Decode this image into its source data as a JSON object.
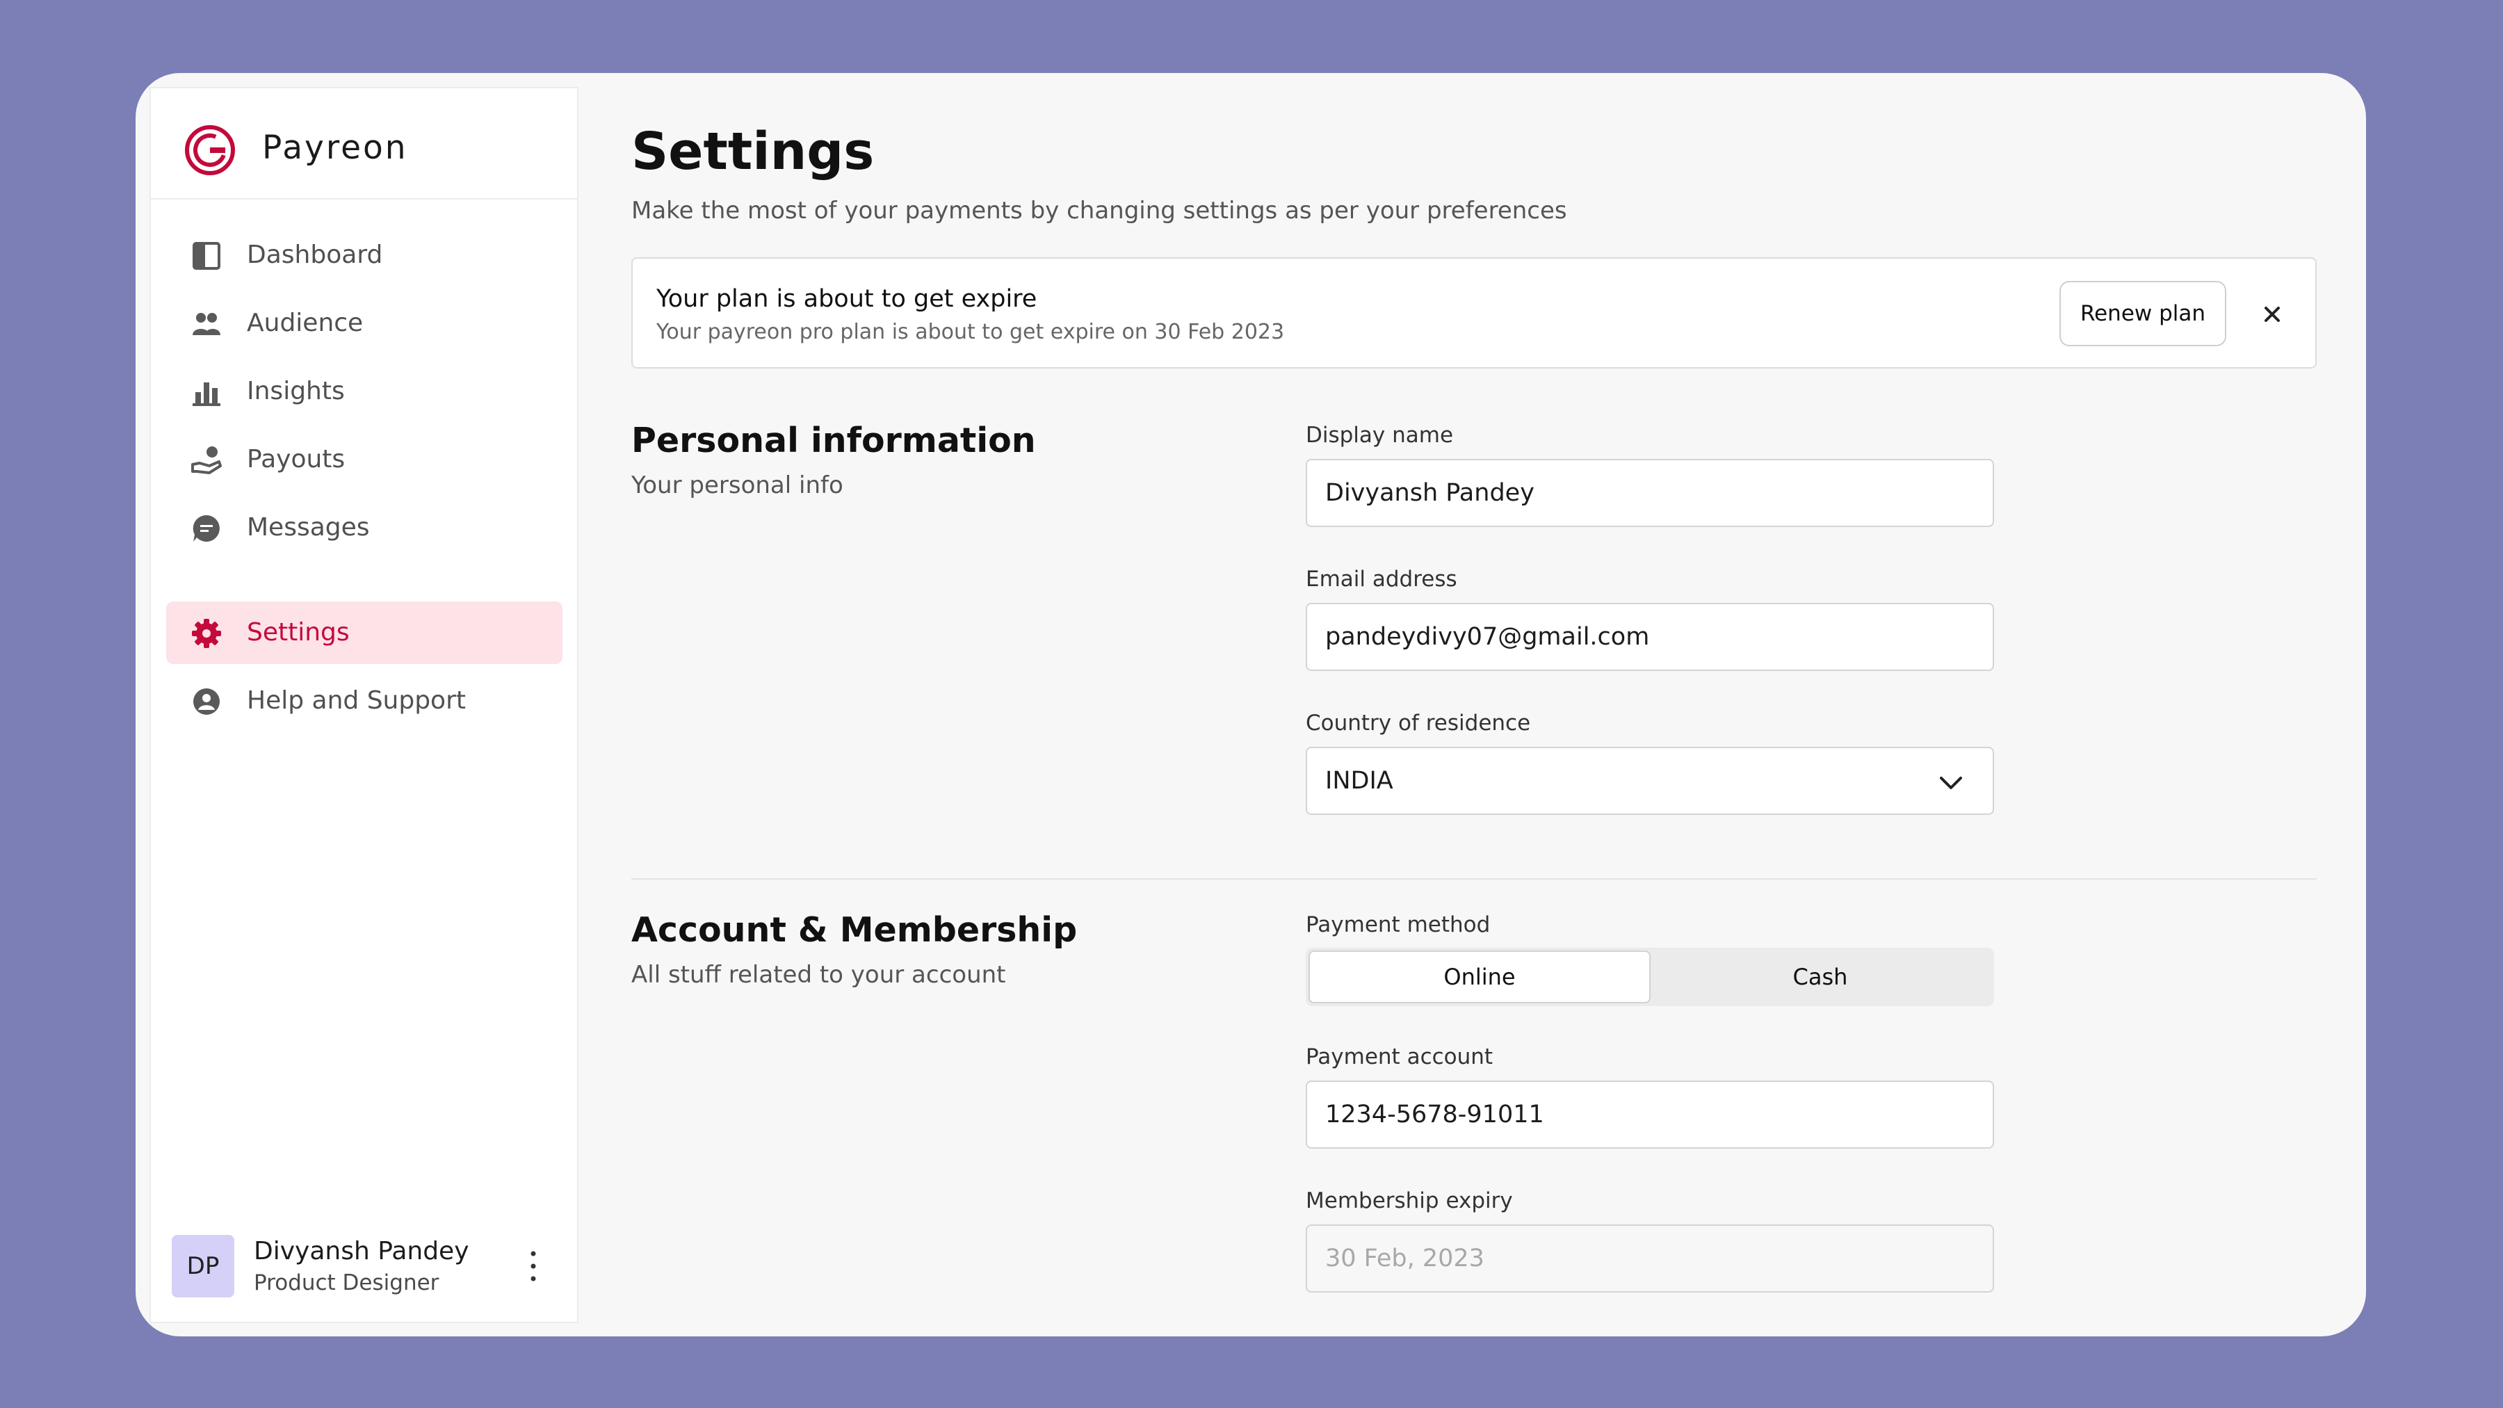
{
  "brand": {
    "name": "Payreon"
  },
  "nav": {
    "items": [
      {
        "label": "Dashboard",
        "icon": "dashboard-icon",
        "active": false
      },
      {
        "label": "Audience",
        "icon": "audience-icon",
        "active": false
      },
      {
        "label": "Insights",
        "icon": "insights-icon",
        "active": false
      },
      {
        "label": "Payouts",
        "icon": "payouts-icon",
        "active": false
      },
      {
        "label": "Messages",
        "icon": "messages-icon",
        "active": false
      },
      {
        "label": "Settings",
        "icon": "gear-icon",
        "active": true
      },
      {
        "label": "Help and Support",
        "icon": "help-icon",
        "active": false
      }
    ]
  },
  "user": {
    "initials": "DP",
    "name": "Divyansh Pandey",
    "role": "Product Designer"
  },
  "page": {
    "title": "Settings",
    "subtitle": "Make the most of your payments by changing settings as per your preferences"
  },
  "banner": {
    "title": "Your plan is about to get expire",
    "message": "Your payreon pro plan is about to get expire on 30 Feb 2023",
    "renew_label": "Renew plan"
  },
  "personal": {
    "title": "Personal information",
    "subtitle": "Your personal info",
    "display_name_label": "Display name",
    "display_name_value": "Divyansh Pandey",
    "email_label": "Email address",
    "email_value": "pandeydivy07@gmail.com",
    "country_label": "Country of residence",
    "country_value": "INDIA"
  },
  "account": {
    "title": "Account & Membership",
    "subtitle": "All stuff related to your account",
    "payment_method_label": "Payment method",
    "payment_method_options": [
      "Online",
      "Cash"
    ],
    "payment_method_selected": "Online",
    "payment_account_label": "Payment account",
    "payment_account_value": "1234-5678-91011",
    "membership_expiry_label": "Membership expiry",
    "membership_expiry_value": "30 Feb, 2023"
  },
  "colors": {
    "background": "#7b7fb6",
    "accent": "#c30a3a",
    "active_bg": "#fde2e8",
    "avatar_bg": "#d4d0f7"
  }
}
